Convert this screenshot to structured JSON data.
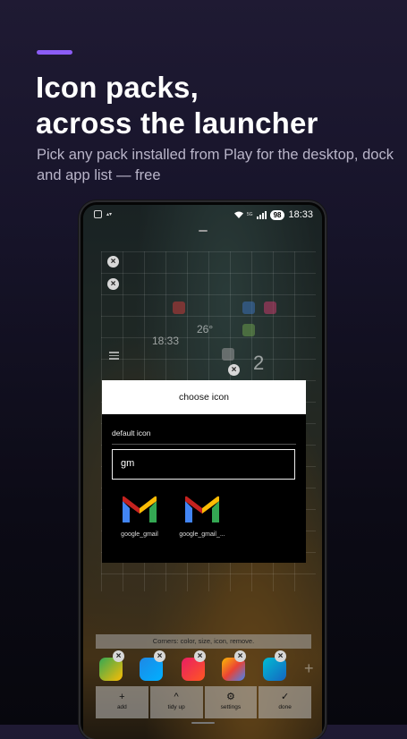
{
  "hero": {
    "title_line1": "Icon packs,",
    "title_line2": "across the launcher",
    "subtitle": "Pick any pack installed from Play for the desktop, dock and app list — free",
    "accent_color": "#8b5cf6"
  },
  "statusbar": {
    "time": "18:33",
    "battery": "98",
    "network": "5G"
  },
  "home": {
    "clock": "18:33",
    "temperature": "26°",
    "page_number": "2",
    "remove_glyph": "×"
  },
  "dialog": {
    "title": "choose icon",
    "default_option": "default icon",
    "search_value": "gm",
    "results": [
      {
        "label": "google_gmail",
        "icon": "gmail-icon"
      },
      {
        "label": "google_gmail_...",
        "icon": "gmail-icon"
      }
    ]
  },
  "bottom": {
    "hint": "Corners: color, size, icon, remove.",
    "add_more_glyph": "+",
    "toolbar": [
      {
        "glyph": "+",
        "label": "add",
        "icon": "plus-icon"
      },
      {
        "glyph": "^",
        "label": "tidy up",
        "icon": "chevron-up-icon"
      },
      {
        "glyph": "⚙",
        "label": "settings",
        "icon": "gear-icon"
      },
      {
        "glyph": "✓",
        "label": "done",
        "icon": "check-icon"
      }
    ]
  }
}
